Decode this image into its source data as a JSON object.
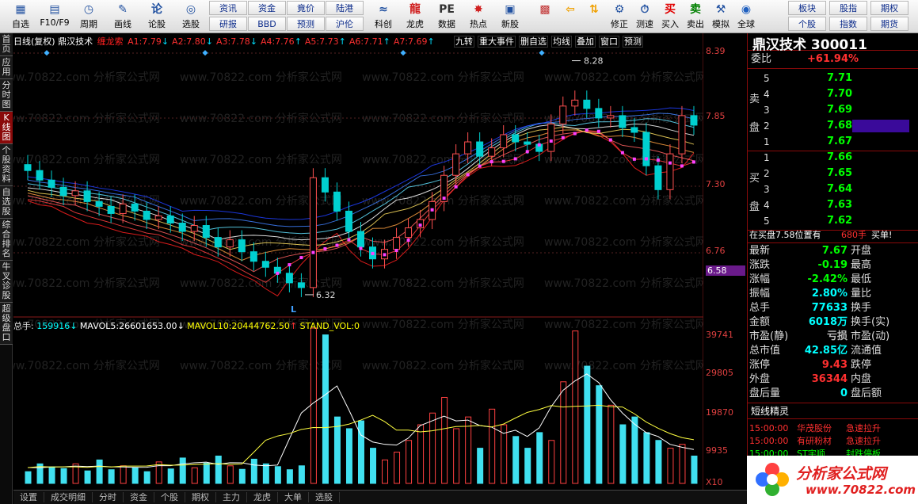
{
  "toolbar": {
    "buttons": [
      {
        "label": "自选",
        "icon": "grid-icon"
      },
      {
        "label": "F10/F9",
        "icon": "document-icon"
      },
      {
        "label": "周期",
        "icon": "clock-icon"
      },
      {
        "label": "画线",
        "icon": "pen-icon"
      },
      {
        "label": "论股",
        "icon": "discuss-icon"
      },
      {
        "label": "选股",
        "icon": "target-icon"
      }
    ],
    "small": [
      [
        "资讯",
        "资金",
        "竟价",
        "陆港"
      ],
      [
        "研报",
        "BBD",
        "预测",
        "沪伦"
      ]
    ],
    "buttons2": [
      {
        "label": "科创",
        "icon": "chart-icon"
      },
      {
        "label": "龙虎",
        "icon": "dragon-icon"
      },
      {
        "label": "数据",
        "icon": "pe-icon"
      },
      {
        "label": "热点",
        "icon": "hot-icon"
      },
      {
        "label": "新股",
        "icon": "new-stock-icon"
      }
    ],
    "buttons3": [
      {
        "label": "",
        "icon": "palette-icon"
      },
      {
        "label": "",
        "icon": "back-arrow-icon"
      },
      {
        "label": "",
        "icon": "updown-icon"
      },
      {
        "label": "修正",
        "icon": "repair-icon"
      },
      {
        "label": "测速",
        "icon": "speed-icon"
      },
      {
        "label": "买入",
        "icon": "buy-icon",
        "glyph": "买"
      },
      {
        "label": "卖出",
        "icon": "sell-icon",
        "glyph": "卖"
      },
      {
        "label": "模拟",
        "icon": "hammer-icon"
      },
      {
        "label": "全球",
        "icon": "globe-icon"
      }
    ],
    "small2": [
      [
        "板块",
        "股指",
        "期权"
      ],
      [
        "个股",
        "指数",
        "期货"
      ]
    ]
  },
  "sidebar": [
    "首页",
    "应用",
    "分时图",
    "K线图",
    "个股资料",
    "自选股",
    "综合排名",
    "牛叉诊股",
    "超级盘口"
  ],
  "chart": {
    "title": "日线(复权)",
    "stock": "鼎汉技术",
    "indicator": "缠龙索",
    "params": [
      {
        "k": "A1:",
        "v": "7.79",
        "d": "↓",
        "c": "#ff3030"
      },
      {
        "k": "A2:",
        "v": "7.80",
        "d": "↓",
        "c": "#ff3030"
      },
      {
        "k": "A3:",
        "v": "7.78",
        "d": "↓",
        "c": "#ff3030"
      },
      {
        "k": "A4:",
        "v": "7.76",
        "d": "↑",
        "c": "#ff3030"
      },
      {
        "k": "A5:",
        "v": "7.73",
        "d": "↑",
        "c": "#ff3030"
      },
      {
        "k": "A6:",
        "v": "7.71",
        "d": "↑",
        "c": "#ff3030"
      },
      {
        "k": "A7:",
        "v": "7.69",
        "d": "↑",
        "c": "#ff3030"
      }
    ],
    "tabs": [
      "九转",
      "重大事件",
      "删自选",
      "均线",
      "叠加",
      "窗口",
      "预测"
    ],
    "high_label": "8.28",
    "low_label": "6.32",
    "low_marker": "L",
    "price_ticks": [
      "8.39",
      "7.85",
      "7.30",
      "6.76",
      "6.58"
    ],
    "vol_ticks": [
      "39741",
      "29805",
      "19870",
      "9935",
      "X10"
    ],
    "vol_info": {
      "label": "总手:",
      "value": "159916",
      "d1": "↓",
      "ma5k": "MAVOL5:",
      "ma5": "26601653.00",
      "d2": "↓",
      "ma10k": "MAVOL10:",
      "ma10": "20444762.50",
      "d3": "↑",
      "stdk": "STAND_VOL:",
      "std": "0"
    },
    "watermark": "www.70822.com 分析家公式网"
  },
  "chart_data": {
    "type": "candlestick",
    "ylim": [
      6.2,
      8.39
    ],
    "high": 8.28,
    "low": 6.32,
    "close": [
      7.36,
      7.28,
      7.22,
      7.15,
      7.19,
      7.1,
      7.06,
      7.0,
      7.08,
      7.02,
      6.95,
      6.98,
      6.92,
      6.85,
      6.9,
      6.8,
      6.72,
      6.78,
      6.68,
      6.6,
      6.55,
      6.5,
      6.42,
      6.38,
      7.3,
      7.18,
      7.02,
      6.85,
      6.72,
      6.62,
      6.7,
      6.8,
      6.88,
      6.95,
      7.1,
      7.32,
      7.5,
      7.6,
      7.48,
      7.55,
      7.66,
      7.6,
      7.58,
      7.52,
      7.75,
      7.9,
      7.95,
      7.88,
      7.8,
      7.82,
      7.72,
      7.68,
      7.4,
      7.2,
      7.5,
      7.82,
      7.74
    ],
    "volume": [
      3000,
      5000,
      4200,
      3800,
      5000,
      3200,
      6000,
      3500,
      4500,
      4000,
      3000,
      5500,
      3700,
      6500,
      4000,
      5200,
      7000,
      4500,
      3600,
      6200,
      5000,
      4300,
      3500,
      4500,
      39741,
      38000,
      17000,
      14000,
      16000,
      9000,
      6000,
      8000,
      11000,
      15000,
      18000,
      22000,
      14000,
      17000,
      9000,
      19000,
      15000,
      12000,
      9000,
      13000,
      11000,
      26000,
      39000,
      30000,
      25000,
      20000,
      15000,
      17000,
      13000,
      11000,
      9000,
      10000,
      7000
    ]
  },
  "rp": {
    "name": "鼎汉技术",
    "code": "300011",
    "weibi_label": "委比",
    "weibi": "+61.94%",
    "sell_label": [
      "卖",
      "盘"
    ],
    "buy_label": [
      "买",
      "盘"
    ],
    "sell": [
      {
        "i": "5",
        "p": "7.71",
        "v": ""
      },
      {
        "i": "4",
        "p": "7.70",
        "v": ""
      },
      {
        "i": "3",
        "p": "7.69",
        "v": ""
      },
      {
        "i": "2",
        "p": "7.68",
        "v": ""
      },
      {
        "i": "1",
        "p": "7.67",
        "v": ""
      }
    ],
    "buy": [
      {
        "i": "1",
        "p": "7.66",
        "v": ""
      },
      {
        "i": "2",
        "p": "7.65",
        "v": ""
      },
      {
        "i": "3",
        "p": "7.64",
        "v": ""
      },
      {
        "i": "4",
        "p": "7.63",
        "v": ""
      },
      {
        "i": "5",
        "p": "7.62",
        "v": ""
      }
    ],
    "zaimai": "在买盘7.58位置有",
    "zaimai_v": "680手",
    "zaimai_tag": "买单!",
    "stats": [
      {
        "k": "最新",
        "v": "7.67",
        "c": "#00ff00",
        "k2": "开盘",
        "v2": ""
      },
      {
        "k": "涨跌",
        "v": "-0.19",
        "c": "#00ff00",
        "k2": "最高",
        "v2": ""
      },
      {
        "k": "涨幅",
        "v": "-2.42%",
        "c": "#00ff00",
        "k2": "最低",
        "v2": ""
      },
      {
        "k": "振幅",
        "v": "2.80%",
        "c": "#00ffff",
        "k2": "量比",
        "v2": ""
      },
      {
        "k": "总手",
        "v": "77633",
        "c": "#00ffff",
        "k2": "换手",
        "v2": ""
      },
      {
        "k": "金额",
        "v": "6018万",
        "c": "#00ffff",
        "k2": "换手(实)",
        "v2": ""
      },
      {
        "k": "市盈(静)",
        "v": "亏损",
        "c": "#bbbbbb",
        "k2": "市盈(动)",
        "v2": ""
      },
      {
        "k": "总市值",
        "v": "42.85亿",
        "c": "#00ffff",
        "k2": "流通值",
        "v2": ""
      },
      {
        "k": "涨停",
        "v": "9.43",
        "c": "#ff3030",
        "k2": "跌停",
        "v2": ""
      },
      {
        "k": "外盘",
        "v": "36344",
        "c": "#ff3030",
        "k2": "内盘",
        "v2": ""
      },
      {
        "k": "盘后量",
        "v": "0",
        "c": "#00ffff",
        "k2": "盘后额",
        "v2": ""
      }
    ],
    "short_title": "短线精灵",
    "short": [
      {
        "t": "15:00:00",
        "n": "华茂股份",
        "e": "急速拉升",
        "c": "#ff3030"
      },
      {
        "t": "15:00:00",
        "n": "有研粉材",
        "e": "急速拉升",
        "c": "#ff3030"
      },
      {
        "t": "15:00:00",
        "n": "ST宇顺",
        "e": "封跌停板",
        "c": "#00ff00"
      }
    ],
    "logo": "分析家公式网",
    "logo_url": "www.70822.com"
  },
  "bottom": [
    "设置",
    "成交明细",
    "分时",
    "资金",
    "个股",
    "期权",
    "主力",
    "龙虎",
    "大单",
    "选股"
  ]
}
